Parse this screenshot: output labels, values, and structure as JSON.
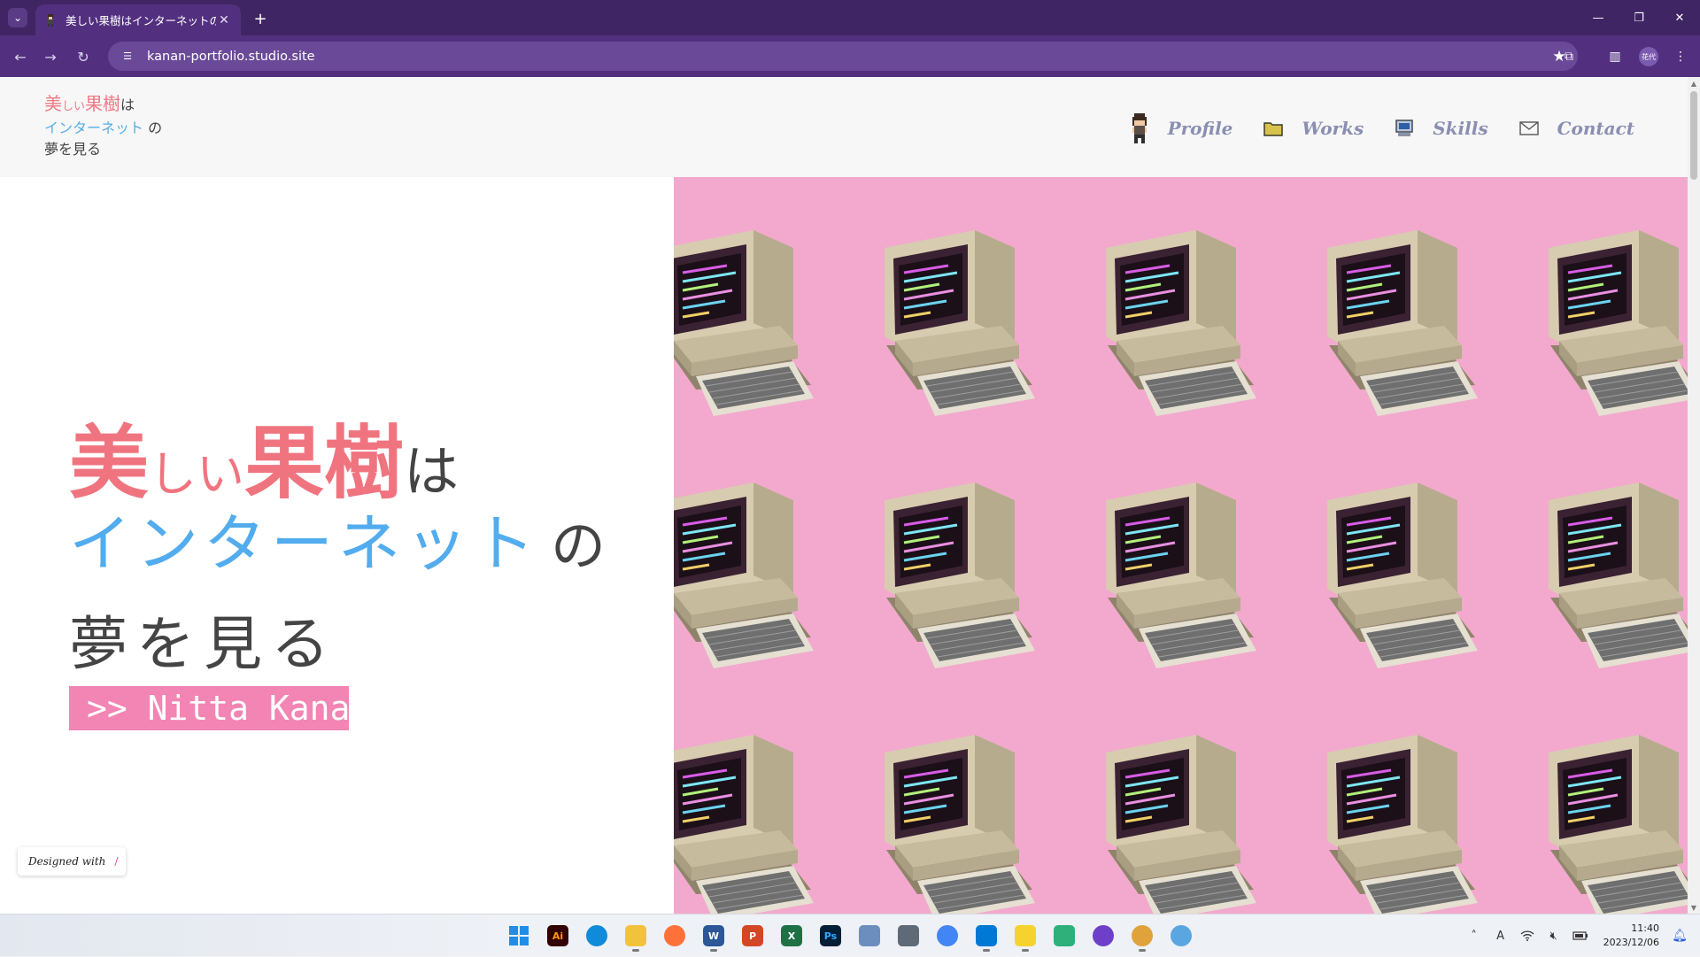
{
  "browser": {
    "tab_title": "美しい果樹はインターネットの夢を見",
    "url": "kanan-portfolio.studio.site",
    "profile_label": "花代"
  },
  "site": {
    "brand": {
      "c1": "美",
      "c2": "しい",
      "c3": "果樹",
      "c4": "は",
      "c5": "インターネット",
      "c6": "の",
      "c7": "夢を見る"
    },
    "nav": [
      {
        "label": "Profile",
        "icon": "pixel-avatar-icon"
      },
      {
        "label": "Works",
        "icon": "folder-icon"
      },
      {
        "label": "Skills",
        "icon": "computer-icon"
      },
      {
        "label": "Contact",
        "icon": "mail-icon"
      }
    ],
    "hero": {
      "c1": "美",
      "c2": "しい",
      "c3": "果樹",
      "c4": "は",
      "c5": "インターネット",
      "c6": "の",
      "c7": "夢を見る",
      "name": ">> Nitta Kana"
    },
    "designed_with": "Designed with",
    "colors": {
      "pink": "#f0747f",
      "blue": "#52acee",
      "badge": "#f285b3",
      "hero_bg": "#f3a9cd",
      "nav_text": "#8a8fb1"
    }
  },
  "taskbar": {
    "apps": [
      {
        "name": "start-button",
        "label": ""
      },
      {
        "name": "illustrator-app",
        "label": "Ai"
      },
      {
        "name": "edge-app",
        "label": ""
      },
      {
        "name": "file-explorer-app",
        "label": ""
      },
      {
        "name": "firefox-app",
        "label": ""
      },
      {
        "name": "word-app",
        "label": "W"
      },
      {
        "name": "powerpoint-app",
        "label": "P"
      },
      {
        "name": "excel-app",
        "label": "X"
      },
      {
        "name": "photoshop-app",
        "label": "Ps"
      },
      {
        "name": "paint-app",
        "label": ""
      },
      {
        "name": "calculator-app",
        "label": ""
      },
      {
        "name": "chrome-app",
        "label": ""
      },
      {
        "name": "vscode-app",
        "label": ""
      },
      {
        "name": "sticky-notes-app",
        "label": ""
      },
      {
        "name": "app-green",
        "label": ""
      },
      {
        "name": "github-desktop-app",
        "label": ""
      },
      {
        "name": "chrome-profile-app",
        "label": ""
      },
      {
        "name": "app-globe",
        "label": ""
      }
    ],
    "time": "11:40",
    "date": "2023/12/06",
    "ime": "A"
  }
}
